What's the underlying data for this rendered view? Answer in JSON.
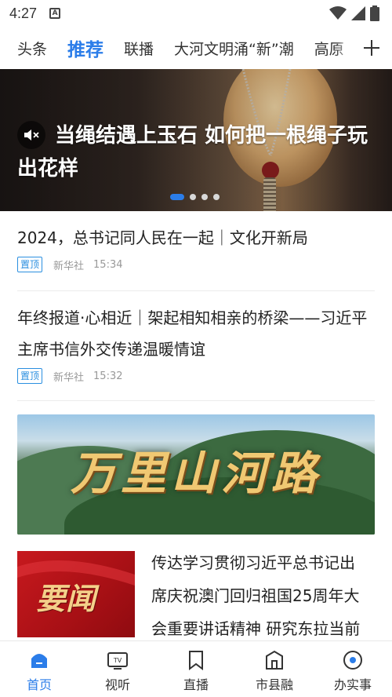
{
  "status_bar": {
    "time": "4:27",
    "notification_icon": "a-icon"
  },
  "tabs": [
    {
      "label": "头条",
      "active": false
    },
    {
      "label": "推荐",
      "active": true
    },
    {
      "label": "联播",
      "active": false
    },
    {
      "label": "大河文明涌“新”潮",
      "active": false
    },
    {
      "label": "高原",
      "active": false
    }
  ],
  "hero": {
    "title": "当绳结遇上玉石 如何把一根绳子玩出花样",
    "slide_count": 4,
    "active_slide": 1
  },
  "news": [
    {
      "title": "2024，总书记同人民在一起｜文化开新局",
      "tag": "置顶",
      "source": "新华社",
      "time": "15:34"
    },
    {
      "title": "年终报道·心相近｜架起相知相亲的桥梁——习近平主席书信外交传递温暖情谊",
      "tag": "置顶",
      "source": "新华社",
      "time": "15:32"
    }
  ],
  "feature": {
    "title": "万里山河路"
  },
  "thumb_news": {
    "thumb_label": "要闻",
    "title": "传达学习贯彻习近平总书记出席庆祝澳门回归祖国25周年大会重要讲话精神 研究东拉当前建设、回头工作和"
  },
  "bottom_nav": [
    {
      "label": "首页",
      "icon": "home-icon",
      "active": true
    },
    {
      "label": "视听",
      "icon": "tv-icon",
      "active": false
    },
    {
      "label": "直播",
      "icon": "bookmark-icon",
      "active": false
    },
    {
      "label": "市县融",
      "icon": "building-icon",
      "active": false
    },
    {
      "label": "办实事",
      "icon": "service-icon",
      "active": false
    }
  ],
  "colors": {
    "accent": "#2b7de9",
    "pin": "#2b8fe0"
  }
}
